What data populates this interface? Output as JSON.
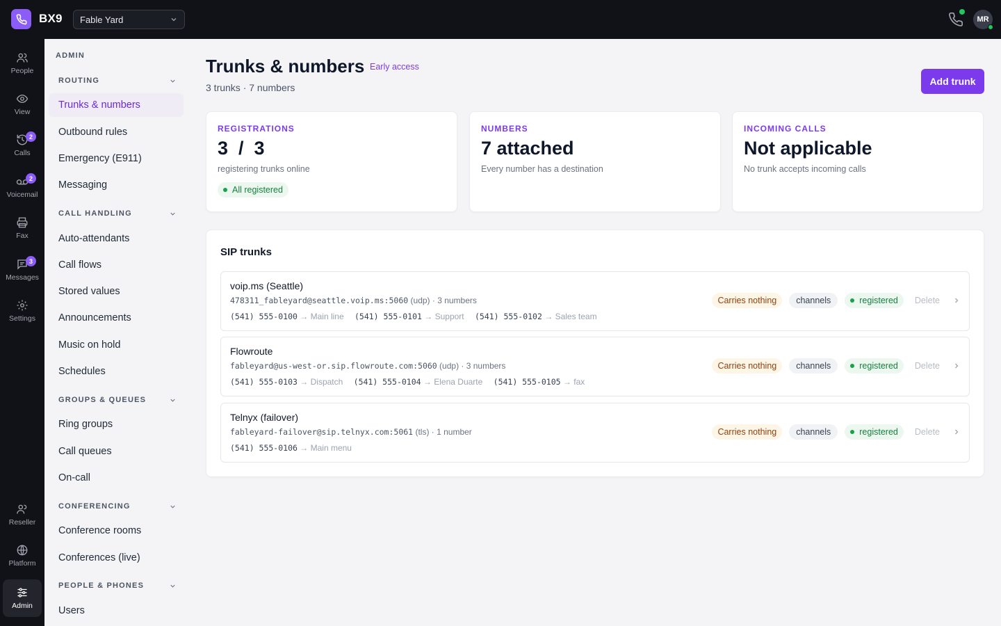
{
  "app": {
    "brand": "BX9",
    "org": "Fable Yard",
    "user_initials": "MR"
  },
  "rail": [
    {
      "label": "People",
      "icon": "people-icon",
      "badge": ""
    },
    {
      "label": "View",
      "icon": "eye-icon",
      "badge": ""
    },
    {
      "label": "Calls",
      "icon": "history-icon",
      "badge": "2"
    },
    {
      "label": "Voicemail",
      "icon": "voicemail-icon",
      "badge": "2"
    },
    {
      "label": "Fax",
      "icon": "printer-icon",
      "badge": ""
    },
    {
      "label": "Messages",
      "icon": "message-icon",
      "badge": "3"
    },
    {
      "label": "Settings",
      "icon": "gear-icon",
      "badge": ""
    },
    {
      "label": "Reseller",
      "icon": "reseller-icon",
      "badge": ""
    },
    {
      "label": "Platform",
      "icon": "globe-icon",
      "badge": ""
    },
    {
      "label": "Admin",
      "icon": "sliders-icon",
      "badge": ""
    }
  ],
  "sidenav": {
    "heading": "ADMIN",
    "sections": [
      {
        "title": "ROUTING",
        "items": [
          "Trunks & numbers",
          "Outbound rules",
          "Emergency (E911)",
          "Messaging"
        ]
      },
      {
        "title": "CALL HANDLING",
        "items": [
          "Auto-attendants",
          "Call flows",
          "Stored values",
          "Announcements",
          "Music on hold",
          "Schedules"
        ]
      },
      {
        "title": "GROUPS & QUEUES",
        "items": [
          "Ring groups",
          "Call queues",
          "On-call"
        ]
      },
      {
        "title": "CONFERENCING",
        "items": [
          "Conference rooms",
          "Conferences (live)"
        ]
      },
      {
        "title": "PEOPLE & PHONES",
        "items": [
          "Users"
        ]
      }
    ]
  },
  "page": {
    "title": "Trunks & numbers",
    "early_access": "Early access",
    "subtitle": "3 trunks · 7 numbers",
    "add_button": "Add trunk"
  },
  "stats": [
    {
      "label": "REGISTRATIONS",
      "value": "3  /  3",
      "desc": "registering trunks online",
      "pill": "All registered"
    },
    {
      "label": "NUMBERS",
      "value": "7 attached",
      "desc": "Every number has a destination",
      "pill": ""
    },
    {
      "label": "INCOMING CALLS",
      "value": "Not applicable",
      "desc": "No trunk accepts incoming calls",
      "pill": ""
    }
  ],
  "trunks": {
    "title": "SIP trunks",
    "items": [
      {
        "name": "voip.ms (Seattle)",
        "uri": "478311_fableyard@seattle.voip.ms:5060",
        "meta": " (udp) · 3 numbers",
        "numbers": [
          {
            "num": "(541) 555-0100",
            "dest": " → Main line"
          },
          {
            "num": "(541) 555-0101",
            "dest": " → Support"
          },
          {
            "num": "(541) 555-0102",
            "dest": " → Sales team"
          }
        ],
        "carries": "Carries nothing",
        "channels": "channels",
        "status": "registered",
        "delete": "Delete"
      },
      {
        "name": "Flowroute",
        "uri": "fableyard@us-west-or.sip.flowroute.com:5060",
        "meta": " (udp) · 3 numbers",
        "numbers": [
          {
            "num": "(541) 555-0103",
            "dest": " → Dispatch"
          },
          {
            "num": "(541) 555-0104",
            "dest": " → Elena Duarte"
          },
          {
            "num": "(541) 555-0105",
            "dest": " → fax"
          }
        ],
        "carries": "Carries nothing",
        "channels": "channels",
        "status": "registered",
        "delete": "Delete"
      },
      {
        "name": "Telnyx (failover)",
        "uri": "fableyard-failover@sip.telnyx.com:5061",
        "meta": " (tls) · 1 number",
        "numbers": [
          {
            "num": "(541) 555-0106",
            "dest": " → Main menu"
          }
        ],
        "carries": "Carries nothing",
        "channels": "channels",
        "status": "registered",
        "delete": "Delete"
      }
    ]
  },
  "colors": {
    "accent": "#7c3aed",
    "topbar": "#111217",
    "success": "#16a34a"
  }
}
